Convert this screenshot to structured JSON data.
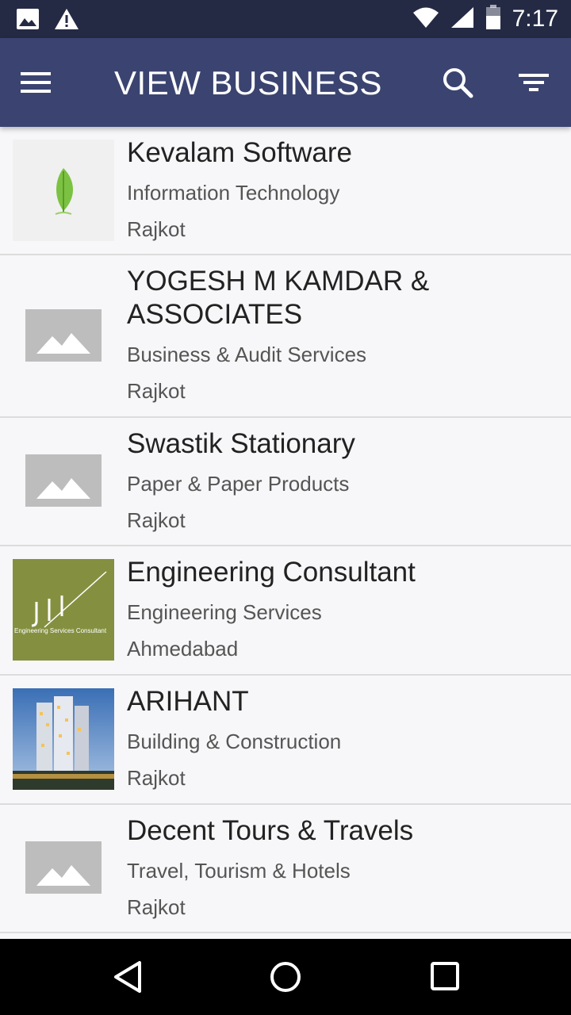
{
  "status_bar": {
    "time": "7:17",
    "icons": [
      "image-notification-icon",
      "warning-icon",
      "wifi-icon",
      "signal-icon",
      "battery-icon"
    ]
  },
  "app_bar": {
    "title": "VIEW BUSINESS",
    "background_color": "#3b4470",
    "icons": [
      "menu-icon",
      "search-icon",
      "filter-icon"
    ]
  },
  "businesses": [
    {
      "name": "Kevalam Software",
      "category": "Information Technology",
      "city": "Rajkot",
      "thumbnail": "leaf-logo"
    },
    {
      "name": "YOGESH M KAMDAR & ASSOCIATES",
      "category": "Business & Audit Services",
      "city": "Rajkot",
      "thumbnail": "placeholder"
    },
    {
      "name": "Swastik Stationary",
      "category": "Paper & Paper Products",
      "city": "Rajkot",
      "thumbnail": "placeholder"
    },
    {
      "name": "Engineering Consultant",
      "category": "Engineering Services",
      "city": "Ahmedabad",
      "thumbnail": "jil-logo",
      "thumbnail_text": "Engineering Services Consultant"
    },
    {
      "name": "ARIHANT",
      "category": "Building & Construction",
      "city": "Rajkot",
      "thumbnail": "building-photo"
    },
    {
      "name": "Decent Tours & Travels",
      "category": "Travel, Tourism & Hotels",
      "city": "Rajkot",
      "thumbnail": "placeholder"
    }
  ],
  "nav_bar": {
    "icons": [
      "back-icon",
      "home-icon",
      "recents-icon"
    ]
  }
}
